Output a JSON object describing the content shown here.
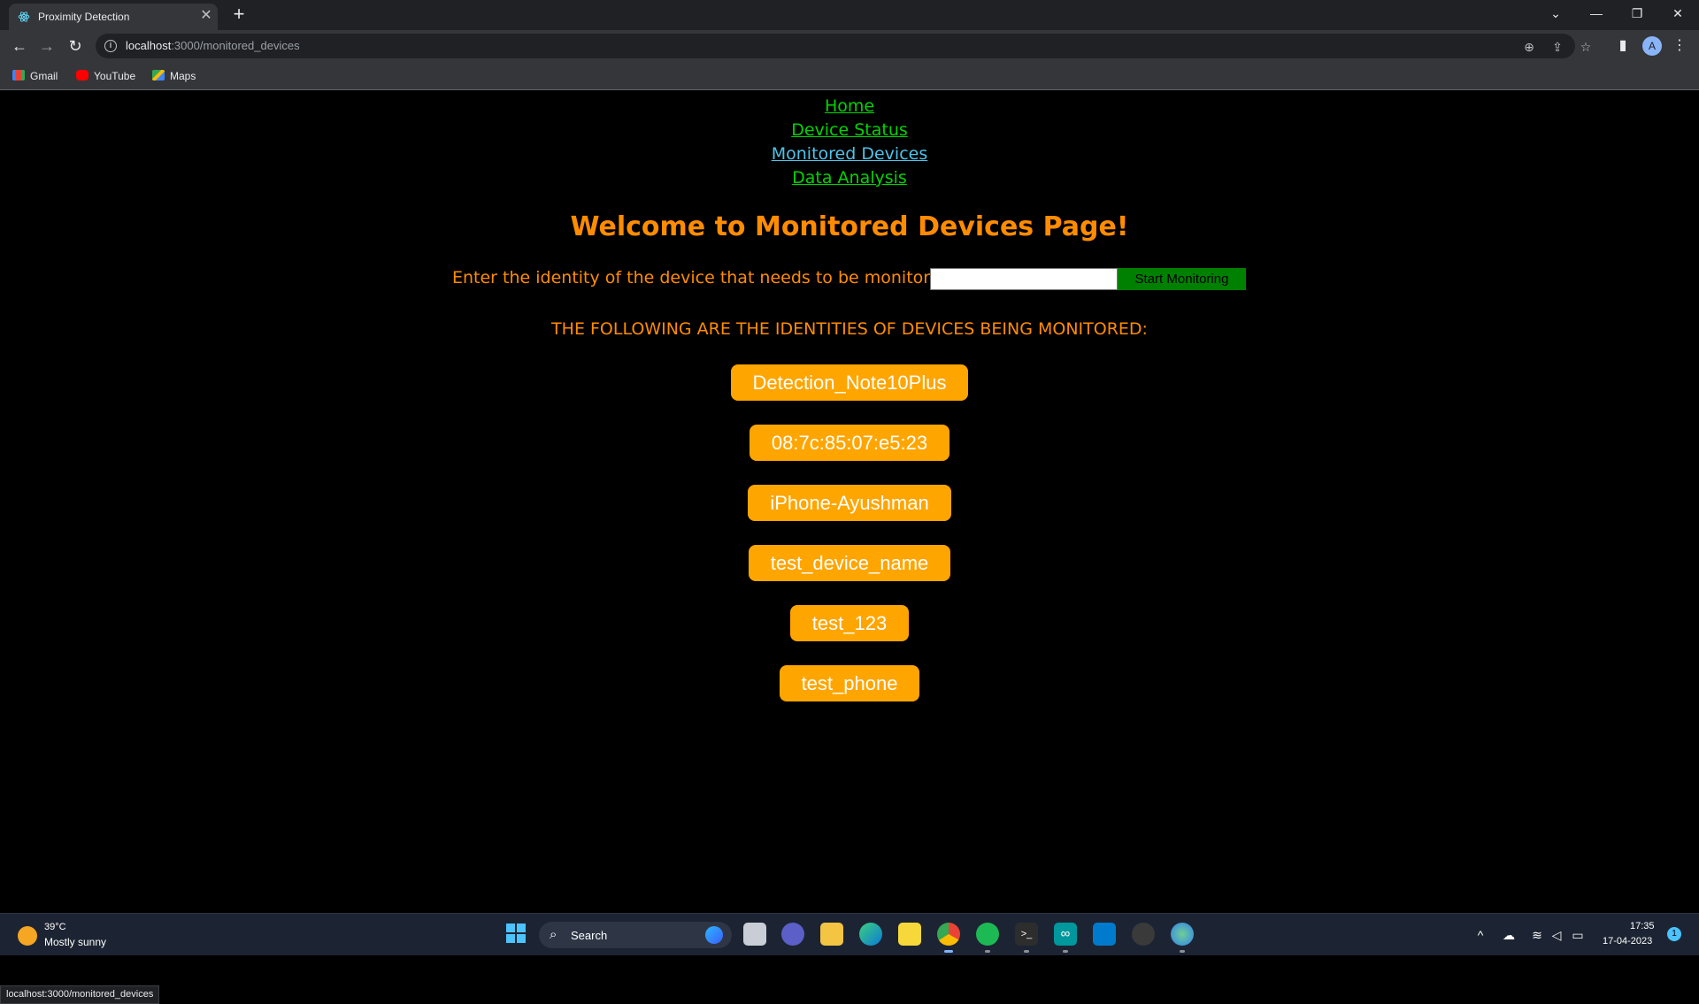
{
  "browser": {
    "tab_title": "Proximity Detection",
    "tab_close": "✕",
    "new_tab": "+",
    "url_host": "localhost",
    "url_rest": ":3000/monitored_devices",
    "bookmarks": [
      "Gmail",
      "YouTube",
      "Maps"
    ],
    "profile_initial": "A",
    "status_url": "localhost:3000/monitored_devices"
  },
  "nav": {
    "links": [
      "Home",
      "Device Status",
      "Monitored Devices",
      "Data Analysis"
    ],
    "active": "Monitored Devices"
  },
  "main": {
    "title": "Welcome to Monitored Devices Page!",
    "input_label": "Enter the identity of the device that needs to be monitored:",
    "input_value": "",
    "button_label": "Start Monitoring",
    "list_heading": "THE FOLLOWING ARE THE IDENTITIES OF DEVICES BEING MONITORED:",
    "devices": [
      "Detection_Note10Plus",
      "08:7c:85:07:e5:23",
      "iPhone-Ayushman",
      "test_device_name",
      "test_123",
      "test_phone"
    ]
  },
  "taskbar": {
    "weather_temp": "39°C",
    "weather_desc": "Mostly sunny",
    "search_label": "Search",
    "time": "17:35",
    "date": "17-04-2023",
    "notification_count": "1"
  },
  "colors": {
    "accent_orange": "#ff8c00",
    "device_badge": "#ffa500",
    "nav_link": "#00d400",
    "nav_active": "#4fc3ea",
    "button_green": "#008000"
  }
}
